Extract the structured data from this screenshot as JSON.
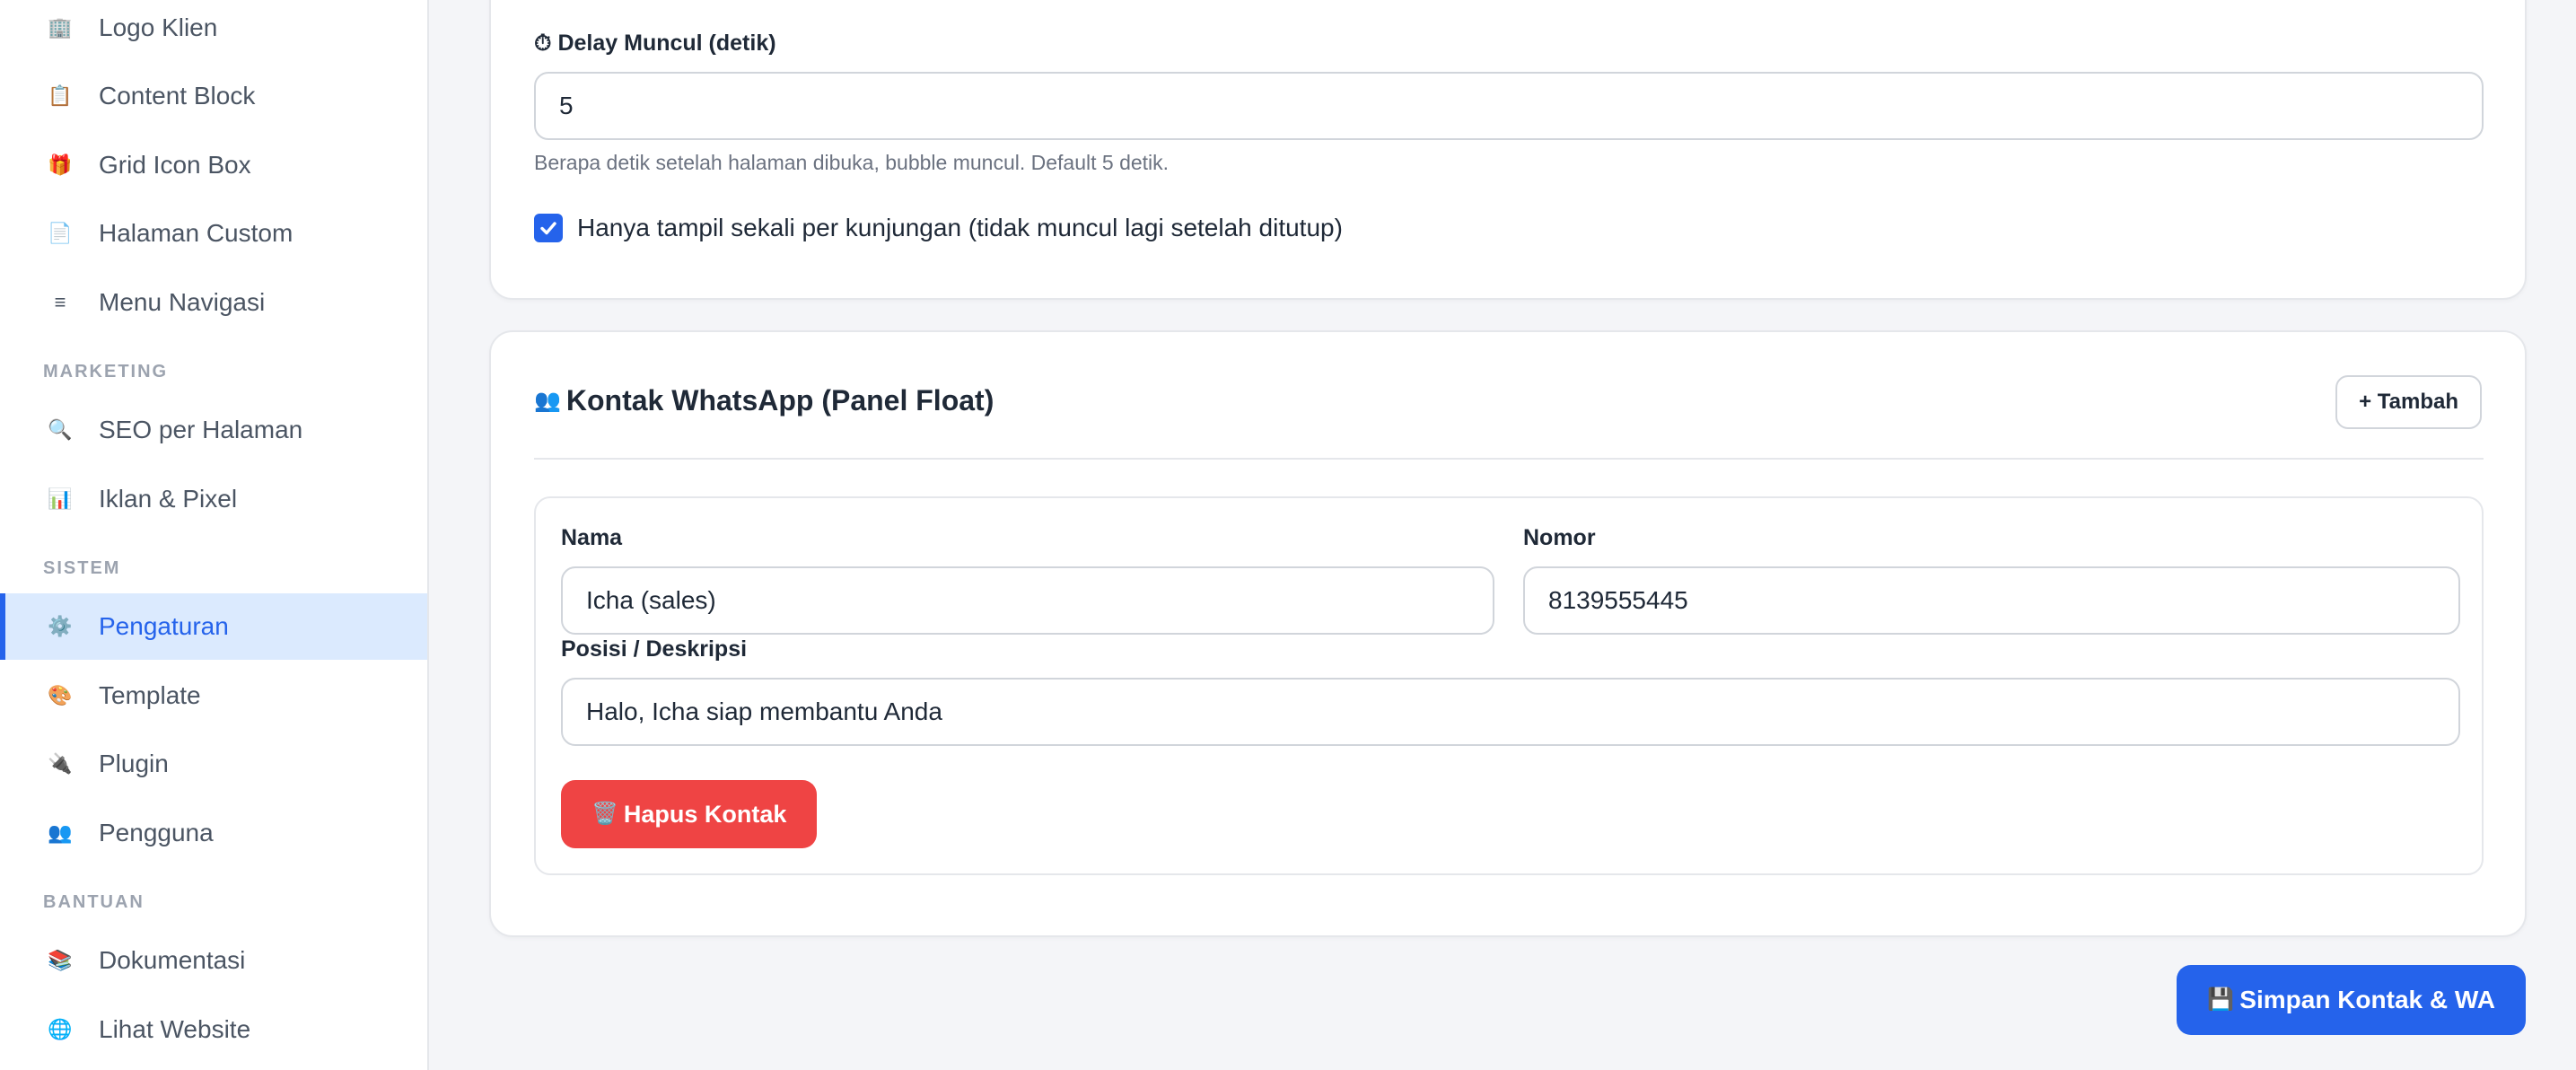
{
  "sidebar": {
    "items_top": [
      {
        "label": "Logo Klien",
        "icon": "building-icon",
        "glyph": "🏢"
      },
      {
        "label": "Content Block",
        "icon": "clipboard-icon",
        "glyph": "📋"
      },
      {
        "label": "Grid Icon Box",
        "icon": "gift-icon",
        "glyph": "🎁"
      },
      {
        "label": "Halaman Custom",
        "icon": "page-icon",
        "glyph": "📄"
      },
      {
        "label": "Menu Navigasi",
        "icon": "menu-icon",
        "glyph": "≡"
      }
    ],
    "section_marketing": "MARKETING",
    "items_marketing": [
      {
        "label": "SEO per Halaman",
        "icon": "search-icon",
        "glyph": "🔍"
      },
      {
        "label": "Iklan & Pixel",
        "icon": "bar-chart-icon",
        "glyph": "📊"
      }
    ],
    "section_sistem": "SISTEM",
    "items_sistem": [
      {
        "label": "Pengaturan",
        "icon": "gear-icon",
        "glyph": "⚙️",
        "active": true
      },
      {
        "label": "Template",
        "icon": "palette-icon",
        "glyph": "🎨"
      },
      {
        "label": "Plugin",
        "icon": "plug-icon",
        "glyph": "🔌"
      },
      {
        "label": "Pengguna",
        "icon": "users-icon",
        "glyph": "👥"
      }
    ],
    "section_bantuan": "BANTUAN",
    "items_bantuan": [
      {
        "label": "Dokumentasi",
        "icon": "books-icon",
        "glyph": "📚"
      },
      {
        "label": "Lihat Website",
        "icon": "globe-icon",
        "glyph": "🌐"
      }
    ]
  },
  "popup_settings": {
    "delay_label_icon": "⏱",
    "delay_label": "Delay Muncul (detik)",
    "delay_value": "5",
    "delay_hint": "Berapa detik setelah halaman dibuka, bubble muncul. Default 5 detik.",
    "show_once_checked": true,
    "show_once_label": "Hanya tampil sekali per kunjungan (tidak muncul lagi setelah ditutup)"
  },
  "wa_contacts": {
    "title_icon": "👥",
    "title": "Kontak WhatsApp (Panel Float)",
    "add_button": "+ Tambah",
    "contact": {
      "name_label": "Nama",
      "name_value": "Icha (sales)",
      "number_label": "Nomor",
      "number_value": "8139555445",
      "position_label": "Posisi / Deskripsi",
      "position_value": "Halo, Icha siap membantu Anda",
      "delete_icon": "🗑️",
      "delete_button": "Hapus Kontak"
    }
  },
  "save_button_icon": "💾",
  "save_button": "Simpan Kontak & WA",
  "colors": {
    "primary": "#2563eb",
    "danger": "#ef4444",
    "active_bg": "#dbeafe",
    "page_bg": "#f4f5f8"
  }
}
